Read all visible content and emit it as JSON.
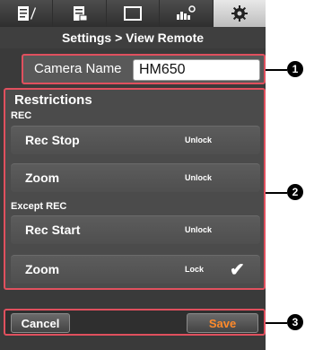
{
  "tabs": [
    {
      "icon": "edit-list-icon",
      "active": false
    },
    {
      "icon": "clip-list-icon",
      "active": false
    },
    {
      "icon": "monitor-icon",
      "active": false
    },
    {
      "icon": "camera-settings-icon",
      "active": false
    },
    {
      "icon": "gear-icon",
      "active": true
    }
  ],
  "header": {
    "title": "Settings > View Remote"
  },
  "camera_name": {
    "label": "Camera Name",
    "value": "HM650"
  },
  "restrictions": {
    "title": "Restrictions",
    "sections": [
      {
        "label": "REC",
        "items": [
          {
            "label": "Rec Stop",
            "state": "Unlock",
            "checked": false
          },
          {
            "label": "Zoom",
            "state": "Unlock",
            "checked": false
          }
        ]
      },
      {
        "label": "Except REC",
        "items": [
          {
            "label": "Rec Start",
            "state": "Unlock",
            "checked": false
          },
          {
            "label": "Zoom",
            "state": "Lock",
            "checked": true
          }
        ]
      }
    ]
  },
  "buttons": {
    "cancel": "Cancel",
    "save": "Save"
  },
  "colors": {
    "save_text": "#ff8a2a",
    "highlight_border": "#e0505e"
  },
  "callouts": [
    "1",
    "2",
    "3"
  ]
}
